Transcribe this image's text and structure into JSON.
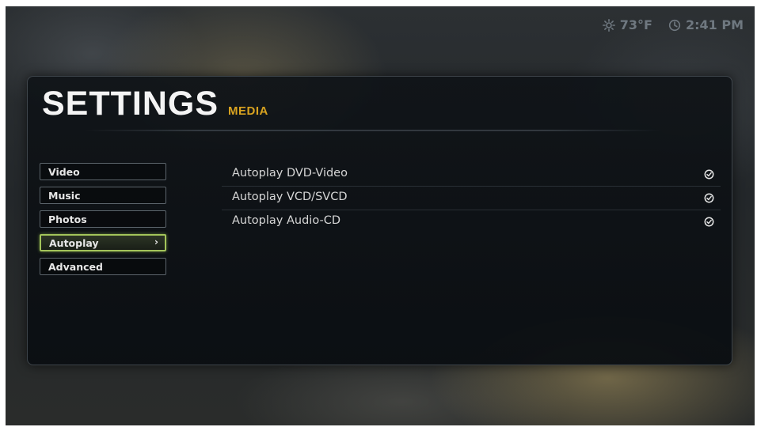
{
  "status": {
    "weather_icon": "sun-icon",
    "temperature": "73°F",
    "clock_icon": "clock-icon",
    "time": "2:41 PM"
  },
  "header": {
    "title": "SETTINGS",
    "subtitle": "MEDIA"
  },
  "sidebar": {
    "items": [
      {
        "label": "Video",
        "selected": false
      },
      {
        "label": "Music",
        "selected": false
      },
      {
        "label": "Photos",
        "selected": false
      },
      {
        "label": "Autoplay",
        "selected": true
      },
      {
        "label": "Advanced",
        "selected": false
      }
    ],
    "selected_chevron": "›"
  },
  "options": [
    {
      "label": "Autoplay DVD-Video",
      "enabled": true,
      "icon": "check-circle-icon"
    },
    {
      "label": "Autoplay VCD/SVCD",
      "enabled": true,
      "icon": "check-circle-icon"
    },
    {
      "label": "Autoplay Audio-CD",
      "enabled": true,
      "icon": "check-circle-icon"
    }
  ],
  "colors": {
    "accent_subtitle": "#d9a320",
    "selection_border": "#a3c45a",
    "status_text": "#6f7880"
  }
}
